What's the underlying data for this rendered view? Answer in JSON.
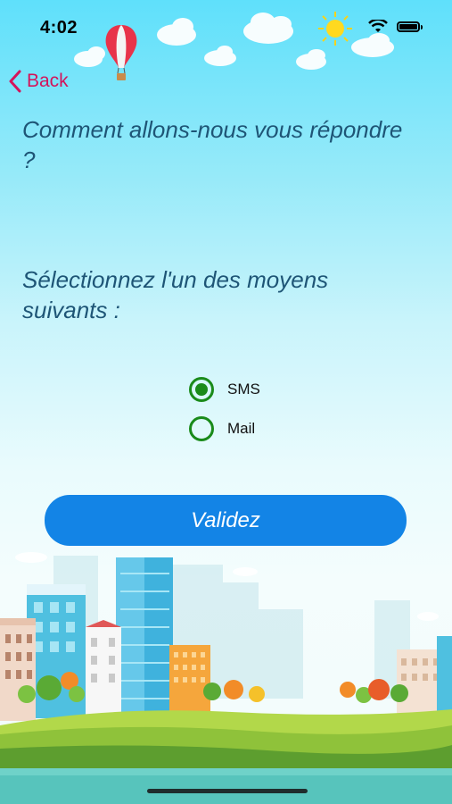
{
  "status_bar": {
    "time": "4:02"
  },
  "nav": {
    "back_label": "Back"
  },
  "main": {
    "title": "Comment allons-nous vous répondre ?",
    "subtitle": "Sélectionnez l'un des moyens suivants :",
    "options": [
      {
        "label": "SMS",
        "selected": true
      },
      {
        "label": "Mail",
        "selected": false
      }
    ],
    "submit_label": "Validez"
  },
  "colors": {
    "back": "#d4145a",
    "title": "#1e5576",
    "radio": "#1a8b1a",
    "button": "#1384e6"
  }
}
